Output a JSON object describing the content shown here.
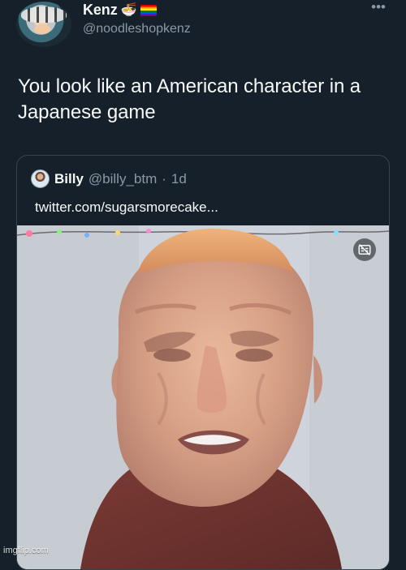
{
  "author": {
    "display_name": "Kenz",
    "handle": "@noodleshopkenz",
    "emoji_icons": [
      "noodle-bowl-icon",
      "rainbow-flag-icon"
    ]
  },
  "tweet": {
    "text": "You look like an American character in a Japanese game"
  },
  "quoted_tweet": {
    "display_name": "Billy",
    "handle": "@billy_btm",
    "separator": "·",
    "time": "1d",
    "link_text": "twitter.com/sugarsmorecake...",
    "media_overlay_icon": "captions-off-icon"
  },
  "icons": {
    "more": "more-options-icon"
  },
  "watermark": "imgflip.com",
  "colors": {
    "background": "#15202b",
    "primary_text": "#f7f9f9",
    "secondary_text": "#8b98a5",
    "border": "#38444d"
  }
}
